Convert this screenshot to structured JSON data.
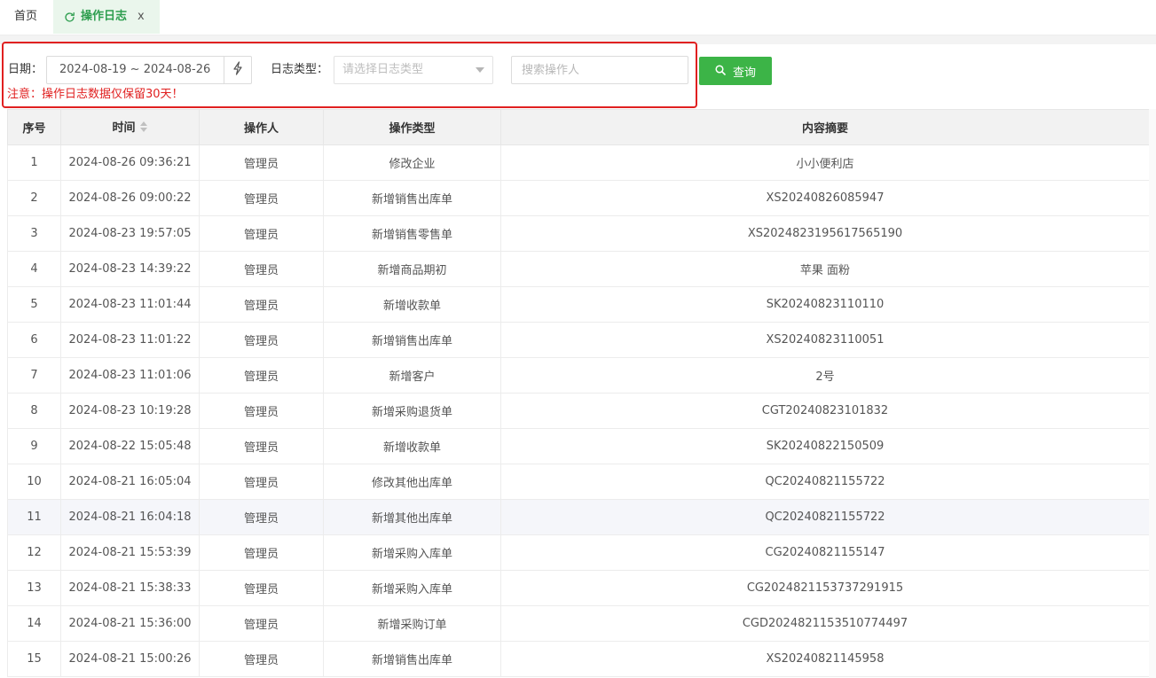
{
  "tabs": {
    "home_label": "首页",
    "active_label": "操作日志",
    "close_glyph": "x"
  },
  "filter": {
    "date_label": "日期：",
    "date_range": "2024-08-19 ~ 2024-08-26",
    "type_label": "日志类型：",
    "type_placeholder": "请选择日志类型",
    "operator_placeholder": "搜索操作人",
    "query_label": "查询",
    "notice": "注意：操作日志数据仅保留30天！"
  },
  "table": {
    "headers": {
      "index": "序号",
      "time": "时间",
      "operator": "操作人",
      "type": "操作类型",
      "summary": "内容摘要"
    },
    "rows": [
      {
        "index": "1",
        "time": "2024-08-26 09:36:21",
        "operator": "管理员",
        "type": "修改企业",
        "summary": "小小便利店"
      },
      {
        "index": "2",
        "time": "2024-08-26 09:00:22",
        "operator": "管理员",
        "type": "新增销售出库单",
        "summary": "XS20240826085947"
      },
      {
        "index": "3",
        "time": "2024-08-23 19:57:05",
        "operator": "管理员",
        "type": "新增销售零售单",
        "summary": "XS2024823195617565190"
      },
      {
        "index": "4",
        "time": "2024-08-23 14:39:22",
        "operator": "管理员",
        "type": "新增商品期初",
        "summary": "苹果 面粉"
      },
      {
        "index": "5",
        "time": "2024-08-23 11:01:44",
        "operator": "管理员",
        "type": "新增收款单",
        "summary": "SK20240823110110"
      },
      {
        "index": "6",
        "time": "2024-08-23 11:01:22",
        "operator": "管理员",
        "type": "新增销售出库单",
        "summary": "XS20240823110051"
      },
      {
        "index": "7",
        "time": "2024-08-23 11:01:06",
        "operator": "管理员",
        "type": "新增客户",
        "summary": "2号"
      },
      {
        "index": "8",
        "time": "2024-08-23 10:19:28",
        "operator": "管理员",
        "type": "新增采购退货单",
        "summary": "CGT20240823101832"
      },
      {
        "index": "9",
        "time": "2024-08-22 15:05:48",
        "operator": "管理员",
        "type": "新增收款单",
        "summary": "SK20240822150509"
      },
      {
        "index": "10",
        "time": "2024-08-21 16:05:04",
        "operator": "管理员",
        "type": "修改其他出库单",
        "summary": "QC20240821155722"
      },
      {
        "index": "11",
        "time": "2024-08-21 16:04:18",
        "operator": "管理员",
        "type": "新增其他出库单",
        "summary": "QC20240821155722"
      },
      {
        "index": "12",
        "time": "2024-08-21 15:53:39",
        "operator": "管理员",
        "type": "新增采购入库单",
        "summary": "CG20240821155147"
      },
      {
        "index": "13",
        "time": "2024-08-21 15:38:33",
        "operator": "管理员",
        "type": "新增采购入库单",
        "summary": "CG2024821153737291915"
      },
      {
        "index": "14",
        "time": "2024-08-21 15:36:00",
        "operator": "管理员",
        "type": "新增采购订单",
        "summary": "CGD2024821153510774497"
      },
      {
        "index": "15",
        "time": "2024-08-21 15:00:26",
        "operator": "管理员",
        "type": "新增销售出库单",
        "summary": "XS20240821145958"
      }
    ],
    "hover_row_index": 10
  },
  "colors": {
    "accent_green": "#3cb447",
    "active_tab_bg": "#eaf6ec",
    "notice_red": "#e02020"
  },
  "icons": {
    "refresh": "refresh-icon",
    "close": "close-icon",
    "flash": "lightning-icon",
    "search": "search-icon",
    "caret": "chevron-down-icon",
    "sort": "sort-icon"
  }
}
